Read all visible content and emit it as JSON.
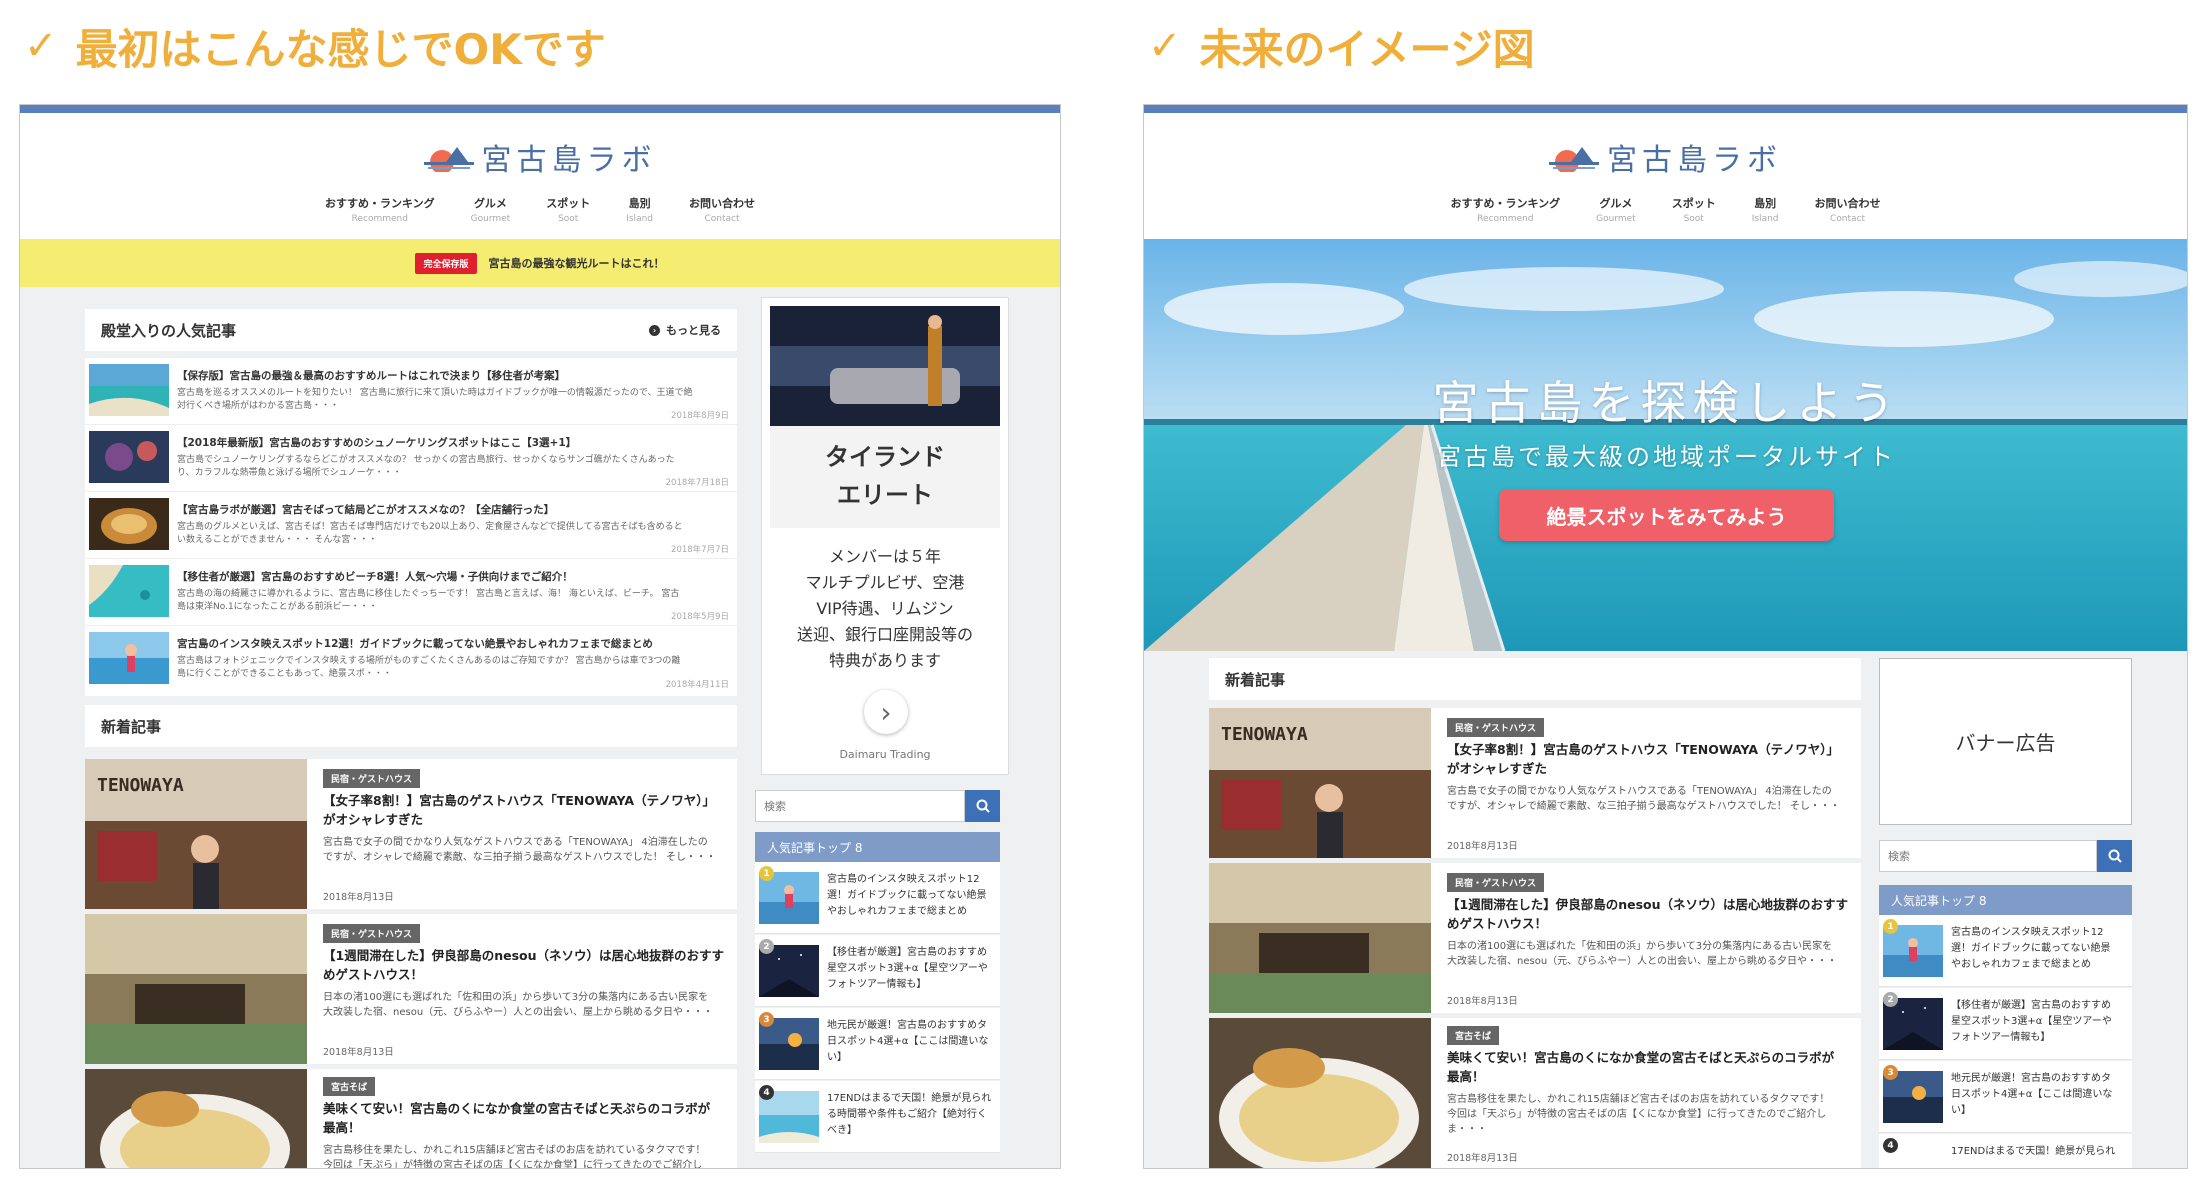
{
  "left_heading": {
    "check": "✓",
    "text": "最初はこんな感じでOKです"
  },
  "right_heading": {
    "check": "✓",
    "text": "未来のイメージ図"
  },
  "site": {
    "logo_text": "宮古島ラボ",
    "nav": [
      {
        "jp": "おすすめ・ランキング",
        "en": "Recommend"
      },
      {
        "jp": "グルメ",
        "en": "Gourmet"
      },
      {
        "jp": "スポット",
        "en": "Soot"
      },
      {
        "jp": "島別",
        "en": "Island"
      },
      {
        "jp": "お問い合わせ",
        "en": "Contact"
      }
    ]
  },
  "notice": {
    "tag": "完全保存版",
    "text": "宮古島の最強な観光ルートはこれ！"
  },
  "popular": {
    "heading": "殿堂入りの人気記事",
    "more": "もっと見る",
    "items": [
      {
        "title": "【保存版】宮古島の最強＆最高のおすすめルートはこれで決まり【移住者が考案】",
        "excerpt": "宮古島を巡るオススメのルートを知りたい！ 宮古島に旅行に来て頂いた時はガイドブックが唯一の情報源だったので、王道で絶",
        "excerpt2": "対行くべき場所がはわかる宮古島・・・",
        "date": "2018年8月9日"
      },
      {
        "title": "【2018年最新版】宮古島のおすすめのシュノーケリングスポットはここ【3選+1】",
        "excerpt": "宮古島でシュノーケリングするならどこがオススメなの？ せっかくの宮古島旅行、せっかくならサンゴ礁がたくさんあった",
        "excerpt2": "り、カラフルな熱帯魚と泳げる場所でシュノーケ・・・",
        "date": "2018年7月18日"
      },
      {
        "title": "【宮古島ラボが厳選】宮古そばって結局どこがオススメなの？【全店舗行った】",
        "excerpt": "宮古島のグルメといえば、宮古そば！宮古そば専門店だけでも20以上あり、定食屋さんなどで提供してる宮古そばも含めると",
        "excerpt2": "い数えることができません・・・ そんな宮・・・",
        "date": "2018年7月7日"
      },
      {
        "title": "【移住者が厳選】宮古島のおすすめビーチ8選！人気〜穴場・子供向けまでご紹介！",
        "excerpt": "宮古島の海の綺麗さに導かれるように、宮古島に移住したぐっちーです！ 宮古島と言えば、海！ 海といえば、ビーチ。 宮古",
        "excerpt2": "島は東洋No.1になったことがある前浜ビー・・・",
        "date": "2018年5月9日"
      },
      {
        "title": "宮古島のインスタ映えスポット12選！ガイドブックに載ってない絶景やおしゃれカフェまで総まとめ",
        "excerpt": "宮古島はフォトジェニックでインスタ映えする場所がものすごくたくさんあるのはご存知ですか？ 宮古島からは車で3つの離",
        "excerpt2": "島に行くことができることもあって、絶景スポ・・・",
        "date": "2018年4月11日"
      }
    ]
  },
  "new_heading": "新着記事",
  "new_items": [
    {
      "cat": "民宿・ゲストハウス",
      "title1": "【女子率8割！】宮古島のゲストハウス「TENOWAYA（テノワヤ）」",
      "title2": "がオシャレすぎた",
      "exc1": "宮古島で女子の間でかなり人気なゲストハウスである「TENOWAYA」 4泊滞在したの",
      "exc2": "ですが、オシャレで綺麗で素敵、な三拍子揃う最高なゲストハウスでした！ そし・・・",
      "date": "2018年8月13日"
    },
    {
      "cat": "民宿・ゲストハウス",
      "title1": "【1週間滞在した】伊良部島のnesou（ネソウ）は居心地抜群のおすす",
      "title2": "めゲストハウス！",
      "exc1": "日本の渚100選にも選ばれた「佐和田の浜」から歩いて3分の集落内にある古い民家を",
      "exc2": "大改装した宿、nesou（元、びらふやー）人との出会い、屋上から眺める夕日や・・・",
      "date": "2018年8月13日"
    },
    {
      "cat": "宮古そば",
      "title1": "美味くて安い！宮古島のくになか食堂の宮古そばと天ぷらのコラボが",
      "title2": "最高！",
      "exc1": "宮古島移住を果たし、かれこれ15店舗ほど宮古そばのお店を訪れているタクマです！",
      "exc2": "今回は「天ぷら」が特徴の宮古そばの店【くになか食堂】に行ってきたのでご紹介し",
      "exc3": "ま・・・",
      "date": "2018年8月13日"
    }
  ],
  "ad": {
    "title1": "タイランド",
    "title2": "エリート",
    "body": [
      "メンバーは５年",
      "マルチプルビザ、空港",
      "VIP待遇、リムジン",
      "送迎、銀行口座開設等の",
      "特典があります"
    ],
    "brand": "Daimaru Trading",
    "arrow": "›"
  },
  "sidebar": {
    "search_placeholder": "検索",
    "search_icon": "magnifier-icon",
    "rank_heading": "人気記事トップ 8",
    "rank": [
      {
        "num": "1",
        "l1": "宮古島のインスタ映えスポット12",
        "l2": "選！ガイドブックに載ってない絶景",
        "l3": "やおしゃれカフェまで総まとめ"
      },
      {
        "num": "2",
        "l1": "【移住者が厳選】宮古島のおすすめ",
        "l2": "星空スポット3選+α【星空ツアーや",
        "l3": "フォトツアー情報も】"
      },
      {
        "num": "3",
        "l1": "地元民が厳選！宮古島のおすすめタ",
        "l2": "日スポット4選+α【ここは間違いな",
        "l3": "い】"
      },
      {
        "num": "4",
        "l1": "17ENDはまるで天国！絶景が見られ",
        "l2": "る時間帯や条件もご紹介【絶対行く",
        "l3": "べき】"
      }
    ],
    "rank4_short": "17ENDはまるで天国！絶景が見られ"
  },
  "hero": {
    "title": "宮古島を探検しよう",
    "subtitle": "宮古島で最大級の地域ポータルサイト",
    "button": "絶景スポットをみてみよう"
  },
  "banner": "バナー広告",
  "colors": {
    "accent_heading": "#f0ae3a",
    "nav_bar": "#5b7fbc",
    "notice_bg": "#f5ec72",
    "hero_button": "#ef6069",
    "rank_header": "#7f9cc8"
  }
}
